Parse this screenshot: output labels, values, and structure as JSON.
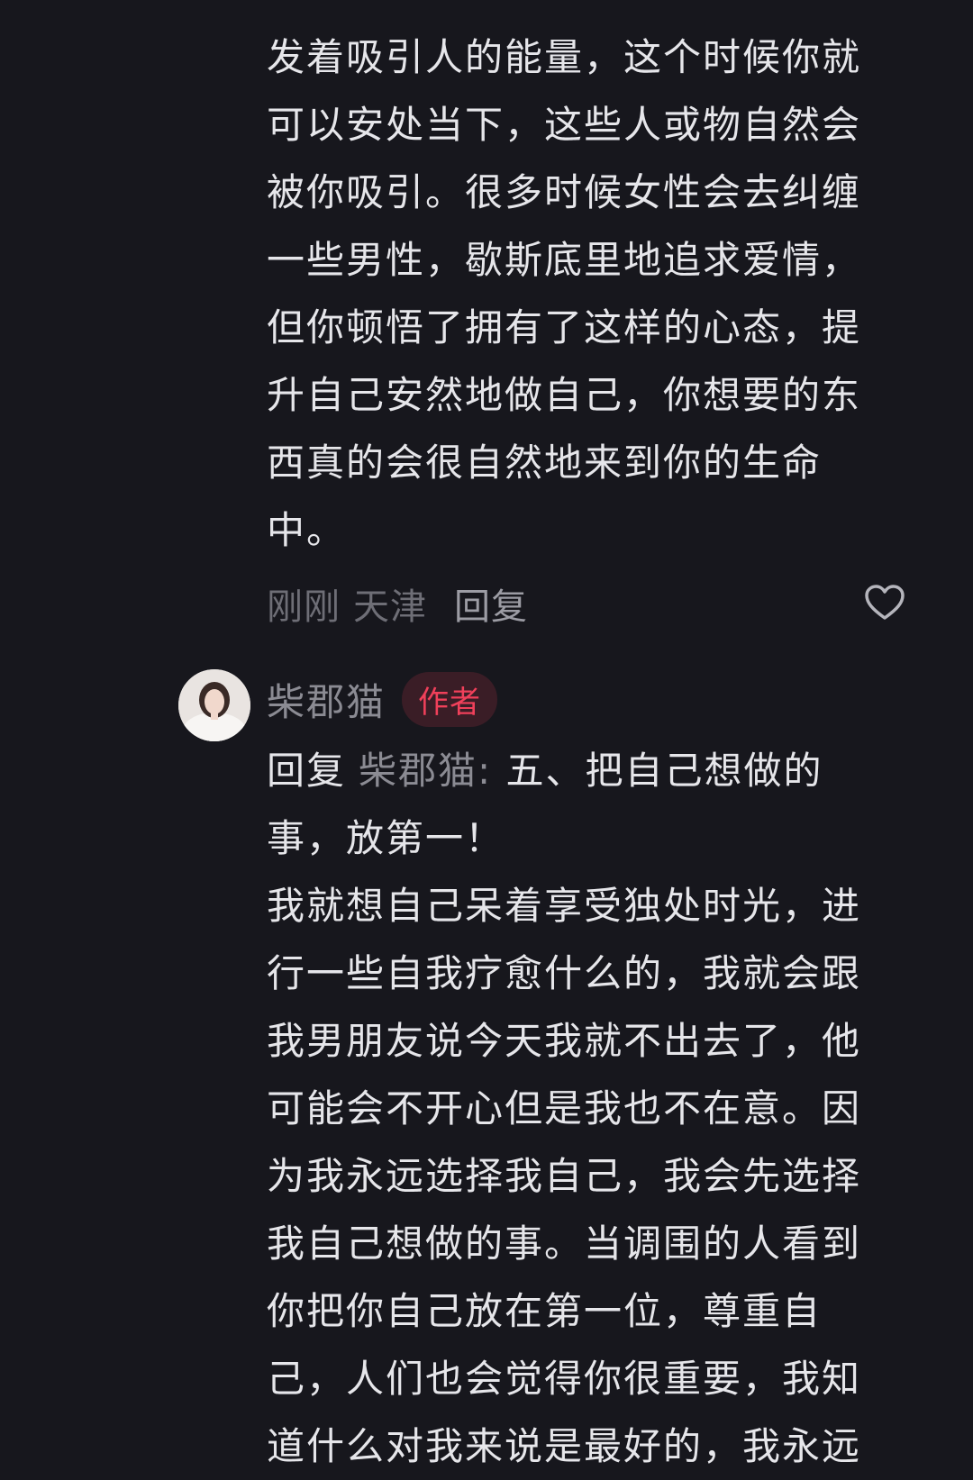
{
  "previous_comment": {
    "text_lines": [
      "发着吸引人的能量，这个时候你就",
      "可以安处当下，这些人或物自然会",
      "被你吸引。很多时候女性会去纠缠",
      "一些男性，歇斯底里地追求爱情，",
      "但你顿悟了拥有了这样的心态，提",
      "升自己安然地做自己，你想要的东",
      "西真的会很自然地来到你的生命",
      "中。"
    ],
    "time": "刚刚",
    "location": "天津",
    "reply_label": "回复",
    "like_icon": "heart-outline-icon"
  },
  "reply_comment": {
    "username": "柴郡猫",
    "badge": "作者",
    "reply_prefix": "回复",
    "reply_target": "柴郡猫:",
    "first_line_rest": "五、把自己想做的",
    "text_lines": [
      "事，放第一！",
      "我就想自己呆着享受独处时光，进",
      "行一些自我疗愈什么的，我就会跟",
      "我男朋友说今天我就不出去了，他",
      "可能会不开心但是我也不在意。因",
      "为我永远选择我自己，我会先选择",
      "我自己想做的事。当调围的人看到",
      "你把你自己放在第一位，尊重自",
      "己，人们也会觉得你很重要，我知",
      "道什么对我来说是最好的，我永远"
    ]
  },
  "colors": {
    "background": "#17171d",
    "text": "#e6e6ea",
    "muted": "#6e6e76",
    "author_badge_text": "#f0405a",
    "author_badge_bg": "#3a1d26"
  }
}
